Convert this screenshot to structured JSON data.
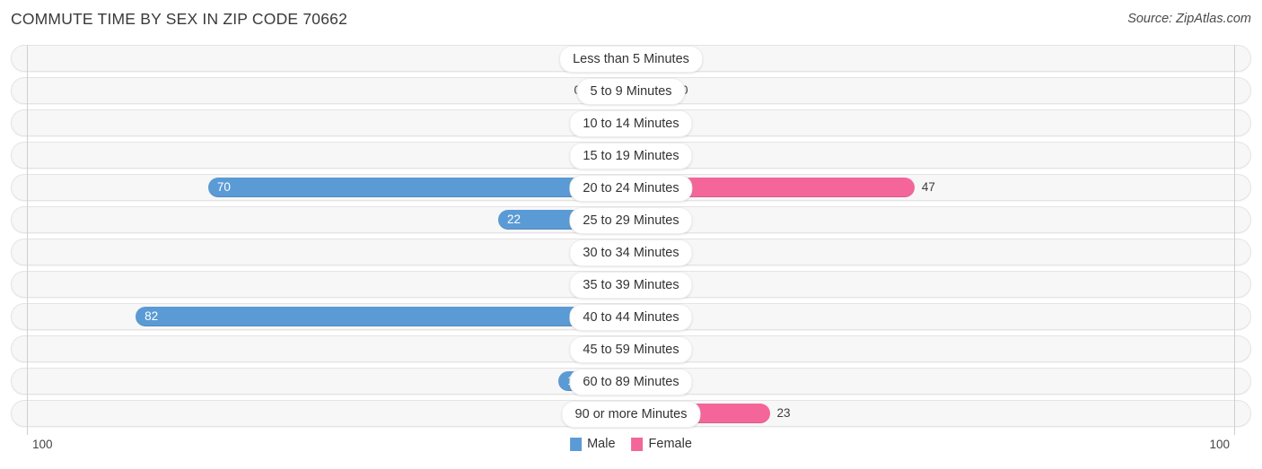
{
  "header": {
    "title": "COMMUTE TIME BY SEX IN ZIP CODE 70662",
    "source": "Source: ZipAtlas.com"
  },
  "legend": {
    "male_label": "Male",
    "female_label": "Female",
    "male_color": "#5b9bd5",
    "female_color": "#f4669a",
    "male_color_light": "#aecbe8",
    "female_color_light": "#f3a8c0"
  },
  "axis": {
    "left_label": "100",
    "right_label": "100",
    "max": 100
  },
  "chart_data": {
    "type": "bar",
    "title": "COMMUTE TIME BY SEX IN ZIP CODE 70662",
    "orientation": "horizontal-diverging",
    "xlabel": "",
    "ylabel": "",
    "xlim": [
      100,
      100
    ],
    "grid": false,
    "legend_position": "bottom-center",
    "categories": [
      "Less than 5 Minutes",
      "5 to 9 Minutes",
      "10 to 14 Minutes",
      "15 to 19 Minutes",
      "20 to 24 Minutes",
      "25 to 29 Minutes",
      "30 to 34 Minutes",
      "35 to 39 Minutes",
      "40 to 44 Minutes",
      "45 to 59 Minutes",
      "60 to 89 Minutes",
      "90 or more Minutes"
    ],
    "series": [
      {
        "name": "Male",
        "values": [
          0,
          0,
          0,
          0,
          70,
          22,
          0,
          0,
          82,
          0,
          12,
          0
        ]
      },
      {
        "name": "Female",
        "values": [
          0,
          0,
          0,
          0,
          47,
          0,
          0,
          0,
          0,
          0,
          0,
          23
        ]
      }
    ]
  }
}
